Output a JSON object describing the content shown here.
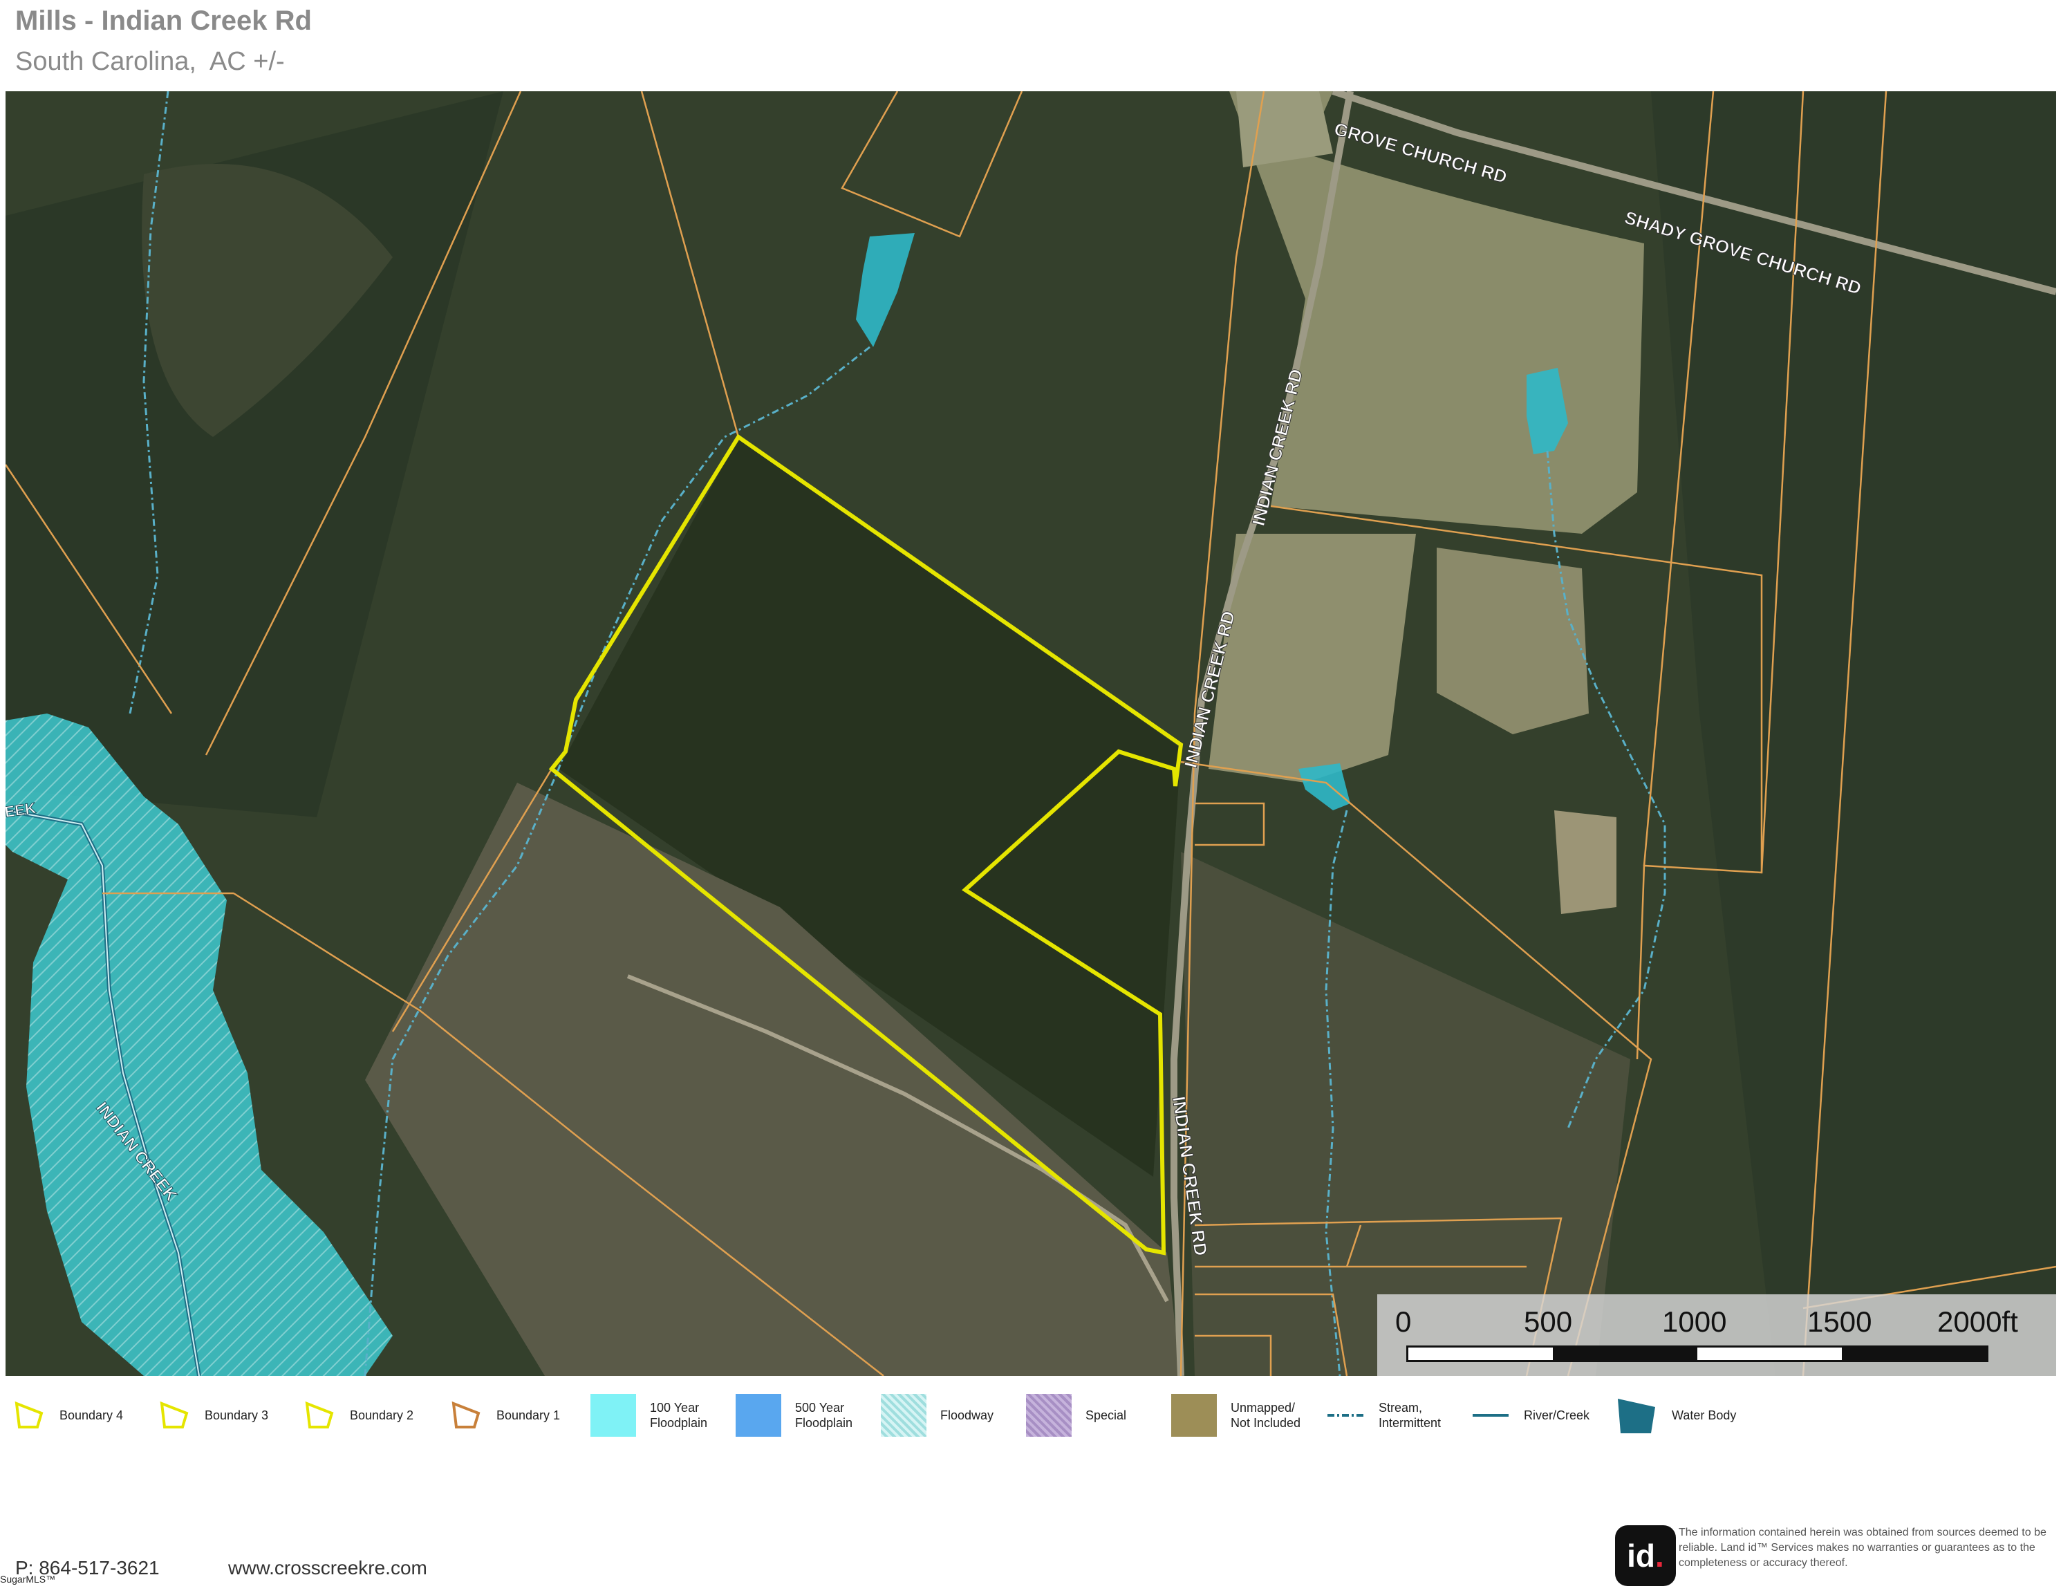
{
  "header": {
    "title": "Mills - Indian Creek Rd",
    "subtitle": "South Carolina,  AC +/-"
  },
  "map": {
    "road_labels": {
      "shady_grove_top": "GROVE CHURCH RD",
      "shady_grove_right": "SHADY GROVE CHURCH RD",
      "indian_creek_upper": "INDIAN CREEK RD",
      "indian_creek_middle": "INDIAN CREEK RD",
      "indian_creek_lower": "INDIAN CREEK RD"
    },
    "water_labels": {
      "creek_edge": "EEK",
      "indian_creek": "INDIAN CREEK"
    },
    "colors": {
      "imagery": "#34402c",
      "parcel_line": "#e0a050",
      "subject_boundary": "#e5e500",
      "floodplain": "#3fd6df",
      "pond": "#2fb8c8",
      "stream": "#59b0c8",
      "river": "#1d6f86"
    },
    "scale": {
      "labels": [
        "0",
        "500",
        "1000",
        "1500",
        "2000ft"
      ]
    }
  },
  "legend": [
    {
      "id": "boundary-4",
      "label": "Boundary 4",
      "icon": "boundary-polygon-icon",
      "color": "#e5e500"
    },
    {
      "id": "boundary-3",
      "label": "Boundary 3",
      "icon": "boundary-polygon-icon",
      "color": "#e5e500"
    },
    {
      "id": "boundary-2",
      "label": "Boundary 2",
      "icon": "boundary-polygon-icon",
      "color": "#e5e500"
    },
    {
      "id": "boundary-1",
      "label": "Boundary 1",
      "icon": "boundary-polygon-icon",
      "color": "#c8803a"
    },
    {
      "id": "floodplain-100",
      "label": "100 Year\nFloodplain",
      "icon": "swatch",
      "color": "#7ff2f6"
    },
    {
      "id": "floodplain-500",
      "label": "500 Year\nFloodplain",
      "icon": "swatch",
      "color": "#59a7ef"
    },
    {
      "id": "floodway",
      "label": "Floodway",
      "icon": "hatched-swatch",
      "color": "#9fdede"
    },
    {
      "id": "special",
      "label": "Special",
      "icon": "hatched-swatch",
      "color": "#a78fc4"
    },
    {
      "id": "unmapped",
      "label": "Unmapped/\nNot Included",
      "icon": "swatch",
      "color": "#9d8e57"
    },
    {
      "id": "stream",
      "label": "Stream,\nIntermittent",
      "icon": "dash-dot-line-icon",
      "color": "#1d6f86"
    },
    {
      "id": "river",
      "label": "River/Creek",
      "icon": "line-icon",
      "color": "#1d6f86"
    },
    {
      "id": "water-body",
      "label": "Water Body",
      "icon": "water-body-icon",
      "color": "#1d6f86"
    }
  ],
  "footer": {
    "phone": "P: 864-517-3621",
    "website": "www.crosscreekre.com",
    "mls_mark": "SugarMLS™",
    "logo_text": "id",
    "disclaimer": "The information contained herein was obtained from sources deemed to be reliable.  Land id™ Services makes no warranties or guarantees as to the completeness or accuracy thereof."
  }
}
